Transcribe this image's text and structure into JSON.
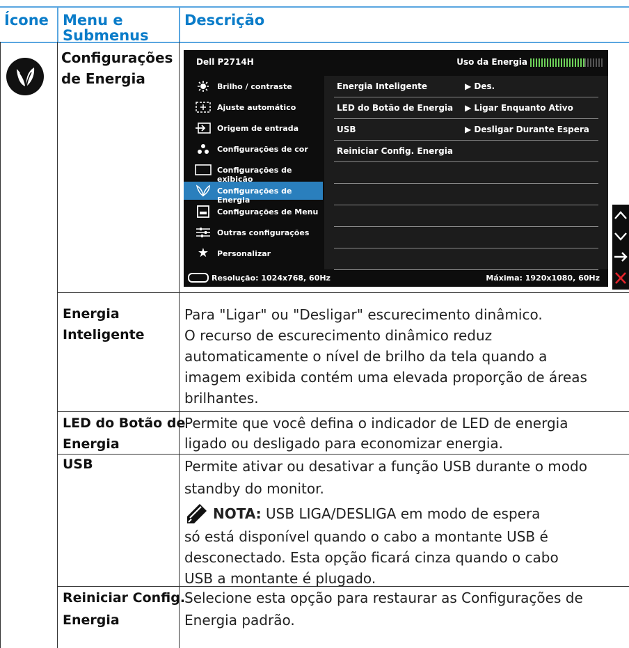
{
  "header": {
    "col_icon": "Ícone",
    "col_menu_line1": "Menu e",
    "col_menu_line2": "Submenus",
    "col_desc": "Descrição"
  },
  "main_entry": {
    "label_line1": "Configurações",
    "label_line2": "de Energia",
    "icon": "leaf-icon"
  },
  "osd": {
    "model": "Dell P2714H",
    "usage_label": "Uso da Energia",
    "left_menu": [
      {
        "label": "Brilho / contraste",
        "icon": "sun-icon"
      },
      {
        "label": "Ajuste automático",
        "icon": "auto-adjust-icon"
      },
      {
        "label": "Origem de entrada",
        "icon": "input-source-icon"
      },
      {
        "label": "Configurações de cor",
        "icon": "color-dots-icon"
      },
      {
        "label": "Configurações de exibição",
        "icon": "display-icon"
      },
      {
        "label": "Configurações de Energia",
        "icon": "leaf-icon",
        "selected": true
      },
      {
        "label": "Configurações de Menu",
        "icon": "menu-icon"
      },
      {
        "label": "Outras configurações",
        "icon": "sliders-icon"
      },
      {
        "label": "Personalizar",
        "icon": "star-icon"
      }
    ],
    "right_rows": [
      {
        "key": "Energia Inteligente",
        "value": "Des."
      },
      {
        "key": "LED do Botão de Energia",
        "value": "Ligar Enquanto Ativo"
      },
      {
        "key": "USB",
        "value": "Desligar Durante Espera"
      },
      {
        "key": "Reiniciar Config. Energia",
        "value": ""
      }
    ],
    "resolution": "Resolução: 1024x768, 60Hz",
    "maximum": "Máxima: 1920x1080, 60Hz",
    "side_buttons": [
      "up-arrow-icon",
      "down-arrow-icon",
      "right-arrow-icon",
      "close-icon"
    ],
    "accent_color": "#2a7fbd",
    "close_color": "#e3232a"
  },
  "rows": [
    {
      "menu_line1": "Energia",
      "menu_line2": "Inteligente",
      "desc_lines": [
        "Para \"Ligar\" ou \"Desligar\" escurecimento dinâmico.",
        "O recurso de escurecimento dinâmico reduz",
        "automaticamente o nível de brilho da tela quando a",
        "imagem exibida contém uma elevada proporção de áreas",
        "brilhantes."
      ]
    },
    {
      "menu_line1": "LED do Botão de",
      "menu_line2": "Energia",
      "desc_lines": [
        "Permite que você defina o indicador de LED de energia",
        "ligado ou desligado para economizar energia."
      ]
    },
    {
      "menu_line1": "USB",
      "menu_line2": "",
      "desc_lines": [
        "Permite ativar ou desativar a função USB durante o modo",
        "standby do monitor."
      ],
      "note_label": "NOTA:",
      "note_lines": [
        "USB LIGA/DESLIGA em modo de espera",
        "só está disponível quando o cabo a montante USB é",
        "desconectado. Esta opção ficará cinza quando o cabo",
        "USB a montante é plugado."
      ]
    },
    {
      "menu_line1": "Reiniciar Config.",
      "menu_line2": "Energia",
      "desc_lines": [
        "Selecione esta opção para restaurar as Configurações de",
        "Energia padrão."
      ]
    }
  ]
}
